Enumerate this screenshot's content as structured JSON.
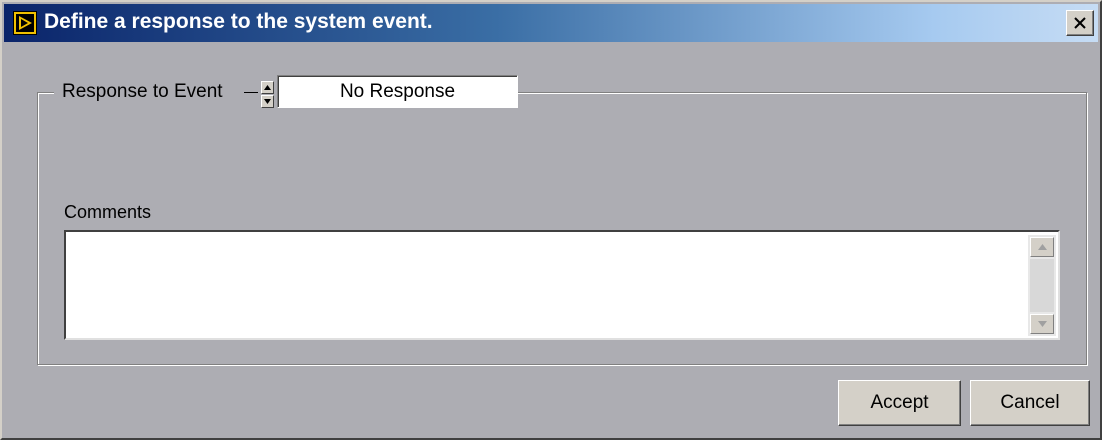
{
  "window": {
    "title": "Define a response to the system event.",
    "icon": "labview-run-icon",
    "close_icon": "close-icon",
    "title_gradient_start": "#0a246a",
    "title_gradient_end": "#a6caf0",
    "face_color": "#adadb3"
  },
  "response_group": {
    "label": "Response to Event",
    "selected_value": "No Response",
    "spinner_icons": [
      "triangle-up-icon",
      "triangle-down-icon"
    ]
  },
  "comments": {
    "label": "Comments",
    "value": ""
  },
  "buttons": {
    "accept_label": "Accept",
    "cancel_label": "Cancel"
  }
}
